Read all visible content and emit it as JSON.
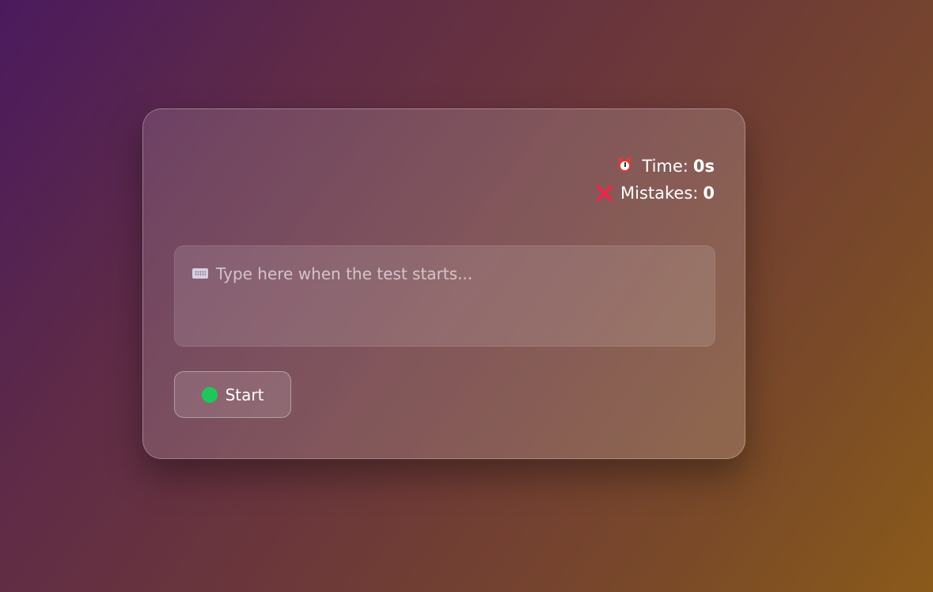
{
  "stats": {
    "time_label": "Time:",
    "time_value": "0s",
    "mistakes_label": "Mistakes:",
    "mistakes_value": "0"
  },
  "typing_area": {
    "placeholder": "Type here when the test starts..."
  },
  "controls": {
    "start_label": "Start"
  },
  "icons": {
    "timer": "alarm-clock-icon",
    "mistakes": "red-x-icon",
    "keyboard": "keyboard-icon",
    "start": "green-circle-icon"
  },
  "colors": {
    "mistake_x": "#e8284a",
    "start_dot": "#1fc75a"
  }
}
